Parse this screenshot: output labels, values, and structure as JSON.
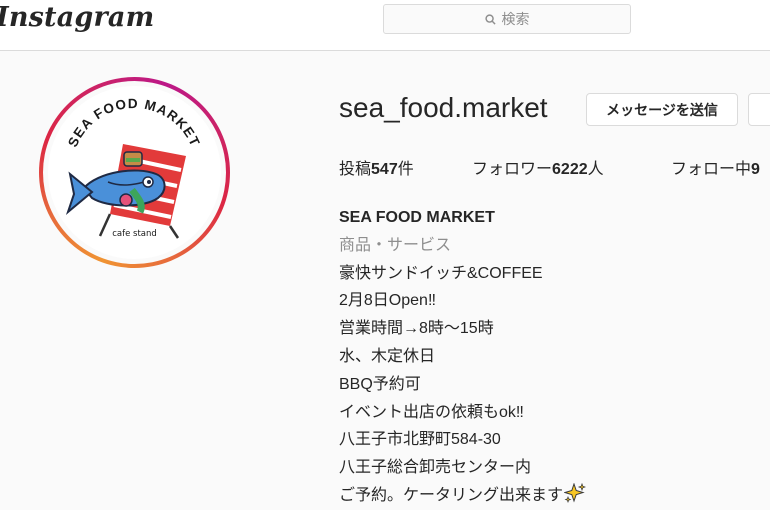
{
  "header": {
    "logo_text": "Instagram",
    "search_placeholder": "検索"
  },
  "profile": {
    "avatar": {
      "arc_text": "SEA FOOD MARKET",
      "sub_text": "cafe stand"
    },
    "username": "sea_food.market",
    "message_button": "メッセージを送信",
    "stats": {
      "posts_label": "投稿",
      "posts_count": "547",
      "posts_unit": "件",
      "followers_label": "フォロワー",
      "followers_count": "6222",
      "followers_unit": "人",
      "following_label": "フォロー中",
      "following_count": "9"
    },
    "bio": {
      "name": "SEA FOOD MARKET",
      "category": "商品・サービス",
      "lines": [
        "豪快サンドイッチ&COFFEE",
        "2月8日Open‼",
        "営業時間→8時〜15時",
        "水、木定休日",
        "BBQ予約可",
        "イベント出店の依頼もok‼",
        "八王子市北野町584-30",
        "八王子総合卸売センター内",
        "ご予約。ケータリング出来ます"
      ]
    }
  },
  "colors": {
    "story_ring": [
      "#f09433",
      "#dc2743",
      "#bc1888"
    ],
    "secondary_text": "#8e8e8e",
    "border": "#dbdbdb"
  },
  "icons": {
    "search": "search-icon",
    "sparkle": "sparkles-emoji"
  }
}
